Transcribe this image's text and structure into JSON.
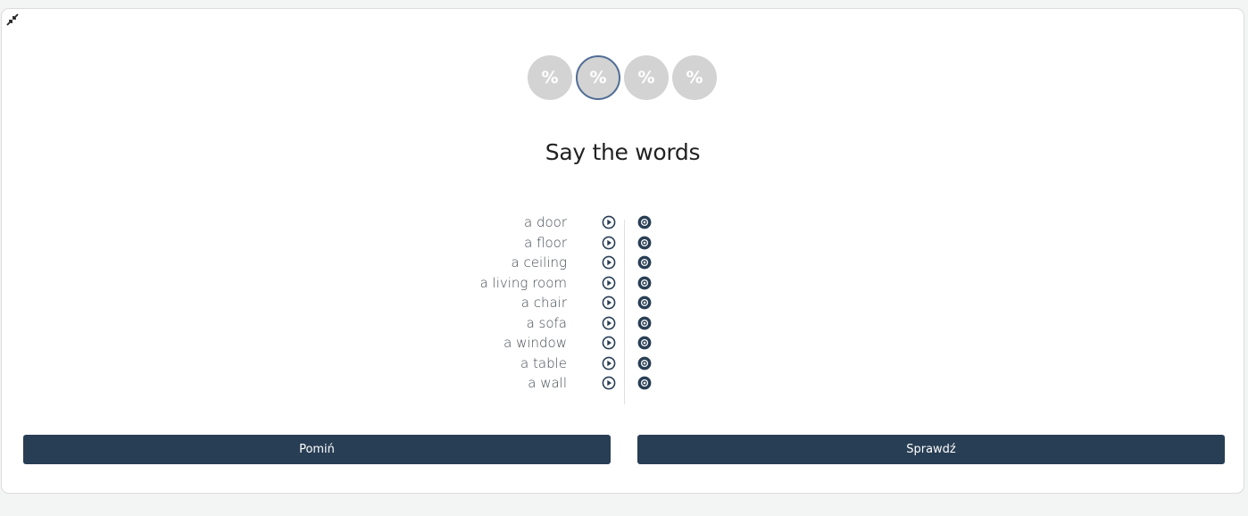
{
  "progress": {
    "steps": [
      "%",
      "%",
      "%",
      "%"
    ],
    "active_index": 1
  },
  "exercise": {
    "title": "Say the words",
    "words": [
      "a door",
      "a floor",
      "a ceiling",
      "a living room",
      "a chair",
      "a sofa",
      "a window",
      "a table",
      "a wall"
    ]
  },
  "buttons": {
    "skip": "Pomiń",
    "check": "Sprawdź"
  },
  "icons": {
    "collapse": "collapse-arrows-icon",
    "play": "play-circle-icon",
    "record": "record-circle-icon"
  },
  "colors": {
    "primary": "#283e54",
    "step_inactive": "#d3d3d3",
    "step_active_border": "#4f6d96",
    "text": "#444a52"
  }
}
